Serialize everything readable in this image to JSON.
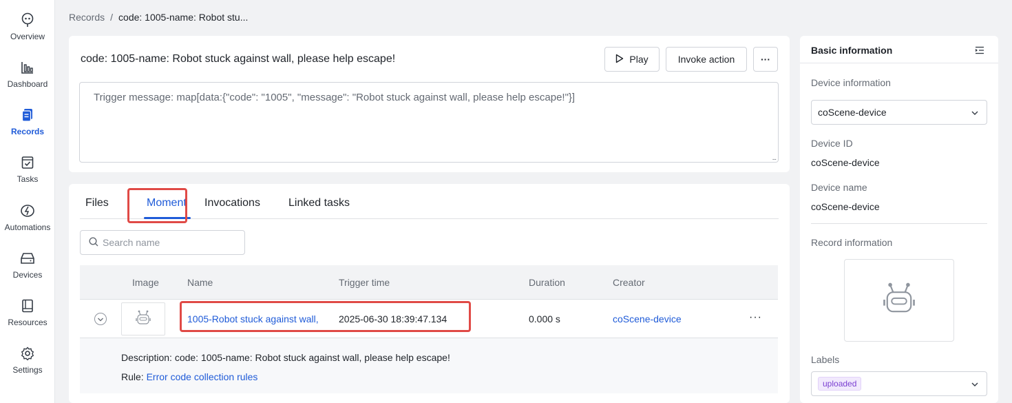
{
  "nav": {
    "items": [
      {
        "label": "Overview",
        "icon": "overview-icon"
      },
      {
        "label": "Dashboard",
        "icon": "dashboard-icon"
      },
      {
        "label": "Records",
        "icon": "records-icon",
        "active": true
      },
      {
        "label": "Tasks",
        "icon": "tasks-icon"
      },
      {
        "label": "Automations",
        "icon": "automations-icon"
      },
      {
        "label": "Devices",
        "icon": "devices-icon"
      },
      {
        "label": "Resources",
        "icon": "resources-icon"
      },
      {
        "label": "Settings",
        "icon": "settings-icon"
      }
    ]
  },
  "breadcrumb": {
    "root": "Records",
    "sep": "/",
    "current": "code: 1005-name: Robot stu..."
  },
  "record": {
    "title": "code: 1005-name: Robot stuck against wall, please help escape!",
    "play_label": "Play",
    "invoke_label": "Invoke action",
    "more_label": "···",
    "trigger_message": "Trigger message: map[data:{\"code\": \"1005\", \"message\": \"Robot stuck against wall, please help escape!\"}]",
    "resize_handle": "..."
  },
  "tabs": [
    {
      "label": "Files"
    },
    {
      "label": "Moment",
      "active": true
    },
    {
      "label": "Invocations"
    },
    {
      "label": "Linked tasks"
    }
  ],
  "search": {
    "placeholder": "Search name"
  },
  "table": {
    "columns": [
      "Image",
      "Name",
      "Trigger time",
      "Duration",
      "Creator"
    ],
    "rows": [
      {
        "name": "1005-Robot stuck against wall,",
        "trigger_time": "2025-06-30 18:39:47.134",
        "duration": "0.000 s",
        "creator": "coScene-device",
        "more": "···",
        "description_label": "Description:",
        "description": "code: 1005-name: Robot stuck against wall, please help escape!",
        "rule_label": "Rule:",
        "rule": "Error code collection rules"
      }
    ]
  },
  "side": {
    "title": "Basic information",
    "device_info_label": "Device information",
    "device_select": "coScene-device",
    "device_id_label": "Device ID",
    "device_id": "coScene-device",
    "device_name_label": "Device name",
    "device_name": "coScene-device",
    "record_info_label": "Record information",
    "labels_label": "Labels",
    "label_tag": "uploaded"
  },
  "colors": {
    "accent": "#1f5bd8",
    "highlight": "#e04a46",
    "tag_bg": "#f1e9fd",
    "tag_text": "#7a3fd1"
  }
}
